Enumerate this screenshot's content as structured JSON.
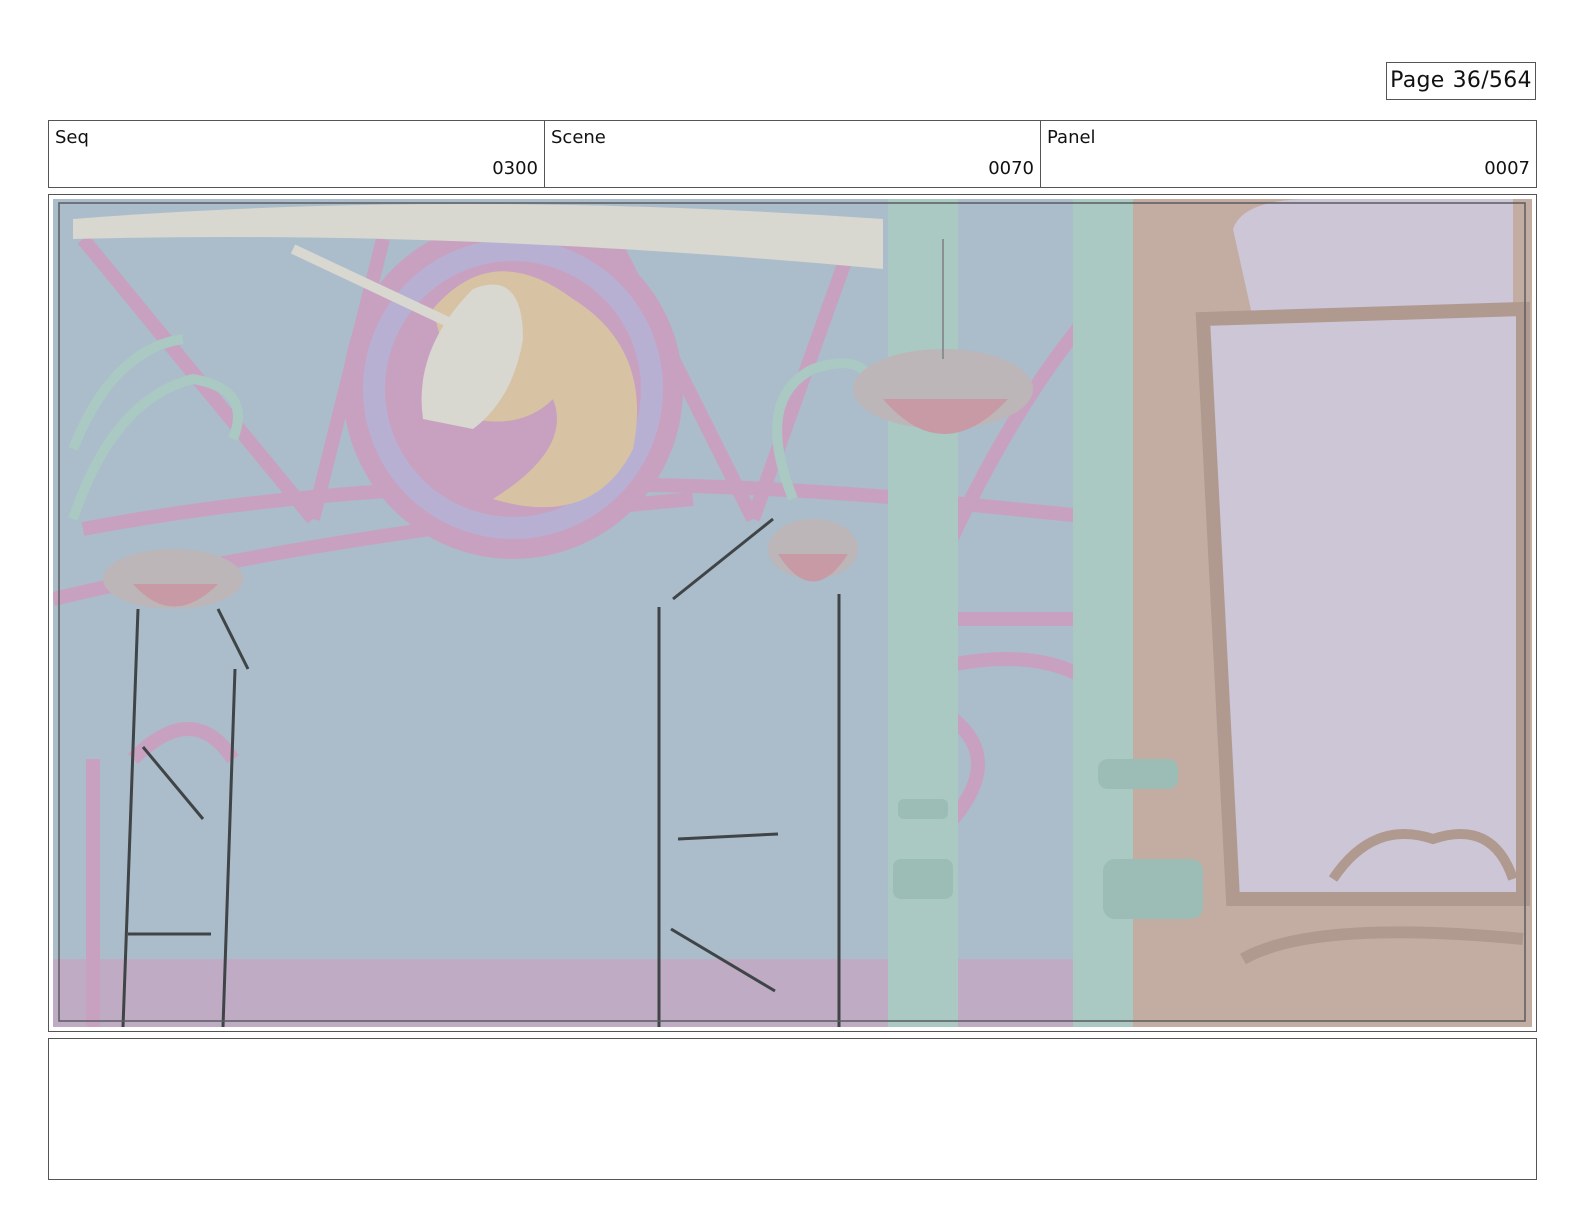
{
  "page": {
    "label": "Page",
    "number": "36/564"
  },
  "header": {
    "seq": {
      "label": "Seq",
      "value": "0300"
    },
    "scene": {
      "label": "Scene",
      "value": "0070"
    },
    "panel": {
      "label": "Panel",
      "value": "0007"
    }
  },
  "panel_image": {
    "icon": "unicon-storyboard-sketch"
  },
  "notes": {
    "text": ""
  },
  "colors": {
    "sky": "#abbccb",
    "pink_frame": "#c9a1c0",
    "teal_metal": "#a9c9c2",
    "tan_wall": "#c3ada3",
    "lilac_window": "#cdc6d6"
  }
}
